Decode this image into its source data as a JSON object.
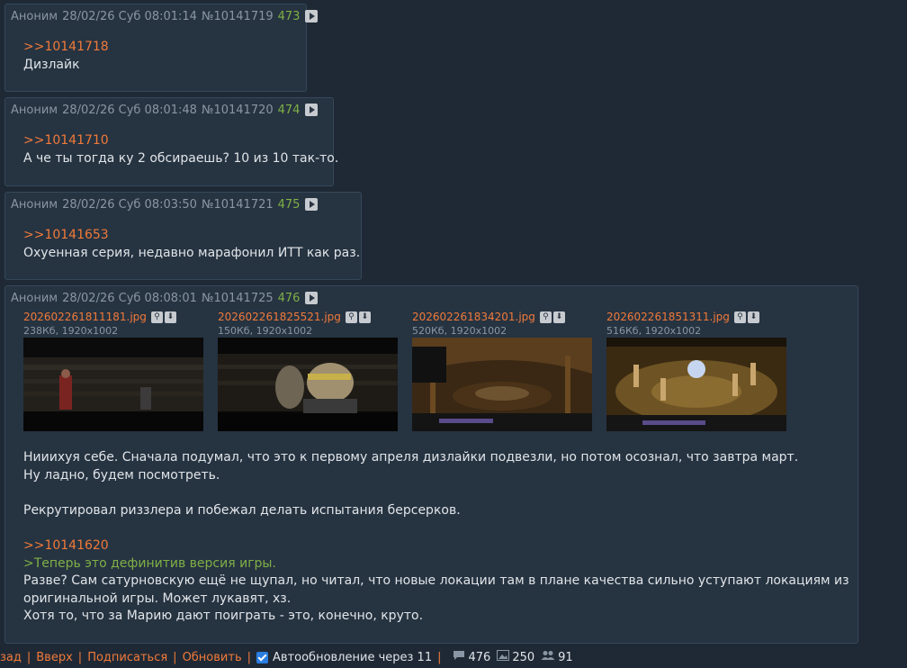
{
  "posts": [
    {
      "name": "Аноним",
      "date": "28/02/26 Суб 08:01:14",
      "num": "№10141719",
      "count": "473",
      "reply_link": ">>10141718",
      "lines": [
        "Дизлайк"
      ]
    },
    {
      "name": "Аноним",
      "date": "28/02/26 Суб 08:01:48",
      "num": "№10141720",
      "count": "474",
      "reply_link": ">>10141710",
      "lines": [
        "А че ты тогда ку 2 обсираешь? 10 из 10 так-то."
      ]
    },
    {
      "name": "Аноним",
      "date": "28/02/26 Суб 08:03:50",
      "num": "№10141721",
      "count": "475",
      "reply_link": ">>10141653",
      "lines": [
        "Охуенная серия, недавно марафонил ИТТ как раз."
      ]
    },
    {
      "name": "Аноним",
      "date": "28/02/26 Суб 08:08:01",
      "num": "№10141725",
      "count": "476",
      "files": [
        {
          "name": "202602261811181.jpg",
          "meta": "238Кб, 1920x1002"
        },
        {
          "name": "202602261825521.jpg",
          "meta": "150Кб, 1920x1002"
        },
        {
          "name": "202602261834201.jpg",
          "meta": "520Кб, 1920x1002"
        },
        {
          "name": "202602261851311.jpg",
          "meta": "516Кб, 1920x1002"
        }
      ],
      "body": {
        "p1": [
          "Нииихуя себе. Сначала подумал, что это к первому апреля дизлайки подвезли, но потом осознал, что завтра март.",
          "Ну ладно, будем посмотреть."
        ],
        "p2": [
          "Рекрутировал риззлера и побежал делать испытания берсерков."
        ],
        "reply_link": ">>10141620",
        "quote": ">Теперь это дефинитив версия игры.",
        "p3": [
          "Разве? Сам сатурновскую ещё не щупал, но читал, что новые локации там в плане качества сильно уступают локациям из",
          "оригинальной игры. Может лукавят, хз.",
          "Хотя то, что за Марию дают поиграть - это, конечно, круто."
        ]
      }
    }
  ],
  "footer": {
    "back": "зад",
    "up": "Вверх",
    "subscribe": "Подписаться",
    "refresh": "Обновить",
    "autoupdate": "Автообновление через 11",
    "posts_count": "476",
    "images_count": "250",
    "users_count": "91"
  },
  "icons": {
    "play": "play-icon",
    "search": "search-icon",
    "download": "download-icon",
    "checkbox": "checkbox-icon",
    "posts": "comment-icon",
    "images": "image-icon",
    "users": "users-icon"
  },
  "colors": {
    "background": "#1f2935",
    "post_bg": "#263341",
    "link": "#f07a3a",
    "count": "#7fb046",
    "quote": "#7fb046",
    "meta": "#8a96a3"
  }
}
